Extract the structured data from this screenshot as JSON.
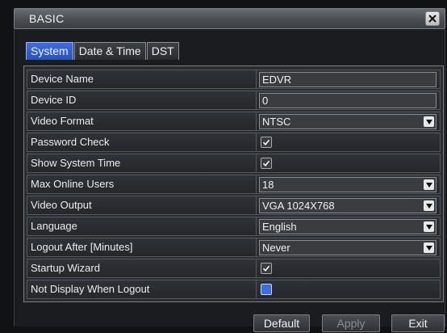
{
  "window": {
    "title": "BASIC"
  },
  "tabs": [
    {
      "label": "System",
      "active": true
    },
    {
      "label": "Date & Time",
      "active": false
    },
    {
      "label": "DST",
      "active": false
    }
  ],
  "rows": [
    {
      "label": "Device Name",
      "type": "text",
      "value": "EDVR"
    },
    {
      "label": "Device ID",
      "type": "text",
      "value": "0"
    },
    {
      "label": "Video Format",
      "type": "select",
      "value": "NTSC"
    },
    {
      "label": "Password Check",
      "type": "checkbox",
      "checked": true
    },
    {
      "label": "Show System Time",
      "type": "checkbox",
      "checked": true
    },
    {
      "label": "Max Online Users",
      "type": "select",
      "value": "18"
    },
    {
      "label": "Video Output",
      "type": "select",
      "value": "VGA 1024X768"
    },
    {
      "label": "Language",
      "type": "select",
      "value": "English"
    },
    {
      "label": "Logout After [Minutes]",
      "type": "select",
      "value": "Never"
    },
    {
      "label": "Startup Wizard",
      "type": "checkbox",
      "checked": true
    },
    {
      "label": "Not Display When Logout",
      "type": "checkbox",
      "checked": false
    }
  ],
  "buttons": {
    "default_label": "Default",
    "apply_label": "Apply",
    "exit_label": "Exit"
  },
  "colors": {
    "accent": "#3d6de0",
    "background": "#1b1c1f"
  }
}
